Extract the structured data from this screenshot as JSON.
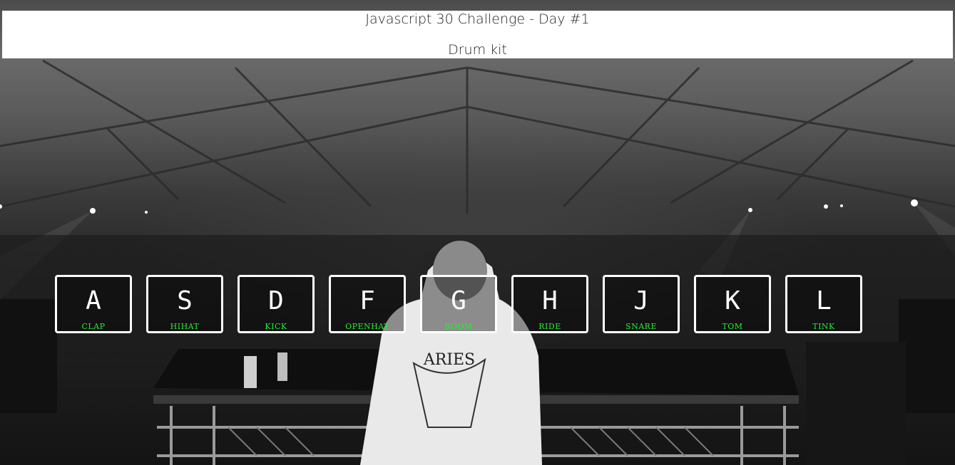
{
  "header": {
    "title": "Javascript 30 Challenge - Day #1",
    "subtitle": "Drum kit"
  },
  "keys": [
    {
      "letter": "A",
      "sound": "CLAP"
    },
    {
      "letter": "S",
      "sound": "HIHAT"
    },
    {
      "letter": "D",
      "sound": "KICK"
    },
    {
      "letter": "F",
      "sound": "OPENHAT"
    },
    {
      "letter": "G",
      "sound": "BOOM"
    },
    {
      "letter": "H",
      "sound": "RIDE"
    },
    {
      "letter": "J",
      "sound": "SNARE"
    },
    {
      "letter": "K",
      "sound": "TOM"
    },
    {
      "letter": "L",
      "sound": "TINK"
    }
  ],
  "background_image_text": "ARIES",
  "colors": {
    "sound_label": "#22ee33",
    "key_border": "#ffffff",
    "header_bg": "#ffffff"
  }
}
